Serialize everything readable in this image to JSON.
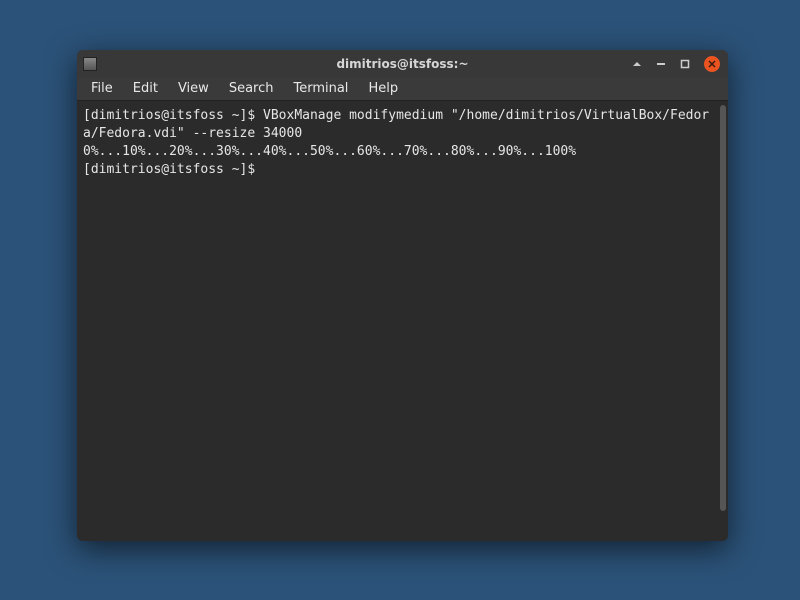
{
  "window": {
    "title": "dimitrios@itsfoss:~"
  },
  "menu": {
    "items": [
      "File",
      "Edit",
      "View",
      "Search",
      "Terminal",
      "Help"
    ]
  },
  "terminal": {
    "lines": [
      "[dimitrios@itsfoss ~]$ VBoxManage modifymedium \"/home/dimitrios/VirtualBox/Fedora/Fedora.vdi\" --resize 34000",
      "0%...10%...20%...30%...40%...50%...60%...70%...80%...90%...100%",
      "[dimitrios@itsfoss ~]$ "
    ]
  }
}
